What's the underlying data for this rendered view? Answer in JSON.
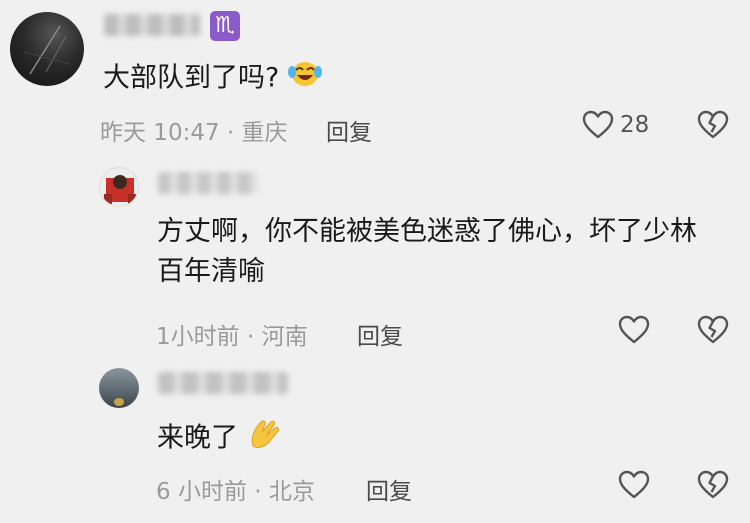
{
  "main_comment": {
    "zodiac_glyph": "♏",
    "text": "大部队到了吗?",
    "emoji": "laughing-crying-emoji",
    "meta": "昨天 10:47 · 重庆",
    "reply_label": "回复",
    "like_count": "28"
  },
  "replies": [
    {
      "text": "方丈啊，你不能被美色迷惑了佛心，坏了少林百年清喻",
      "meta": "1小时前 · 河南",
      "reply_label": "回复"
    },
    {
      "text": "来晚了",
      "emoji": "clap-hands-emoji",
      "meta": "6 小时前 · 北京",
      "reply_label": "回复"
    }
  ],
  "colors": {
    "background": "#f0f0f0",
    "zodiac_badge": "#8b5cc9",
    "meta_text": "#9a9a9a",
    "icon_stroke": "#555555"
  }
}
